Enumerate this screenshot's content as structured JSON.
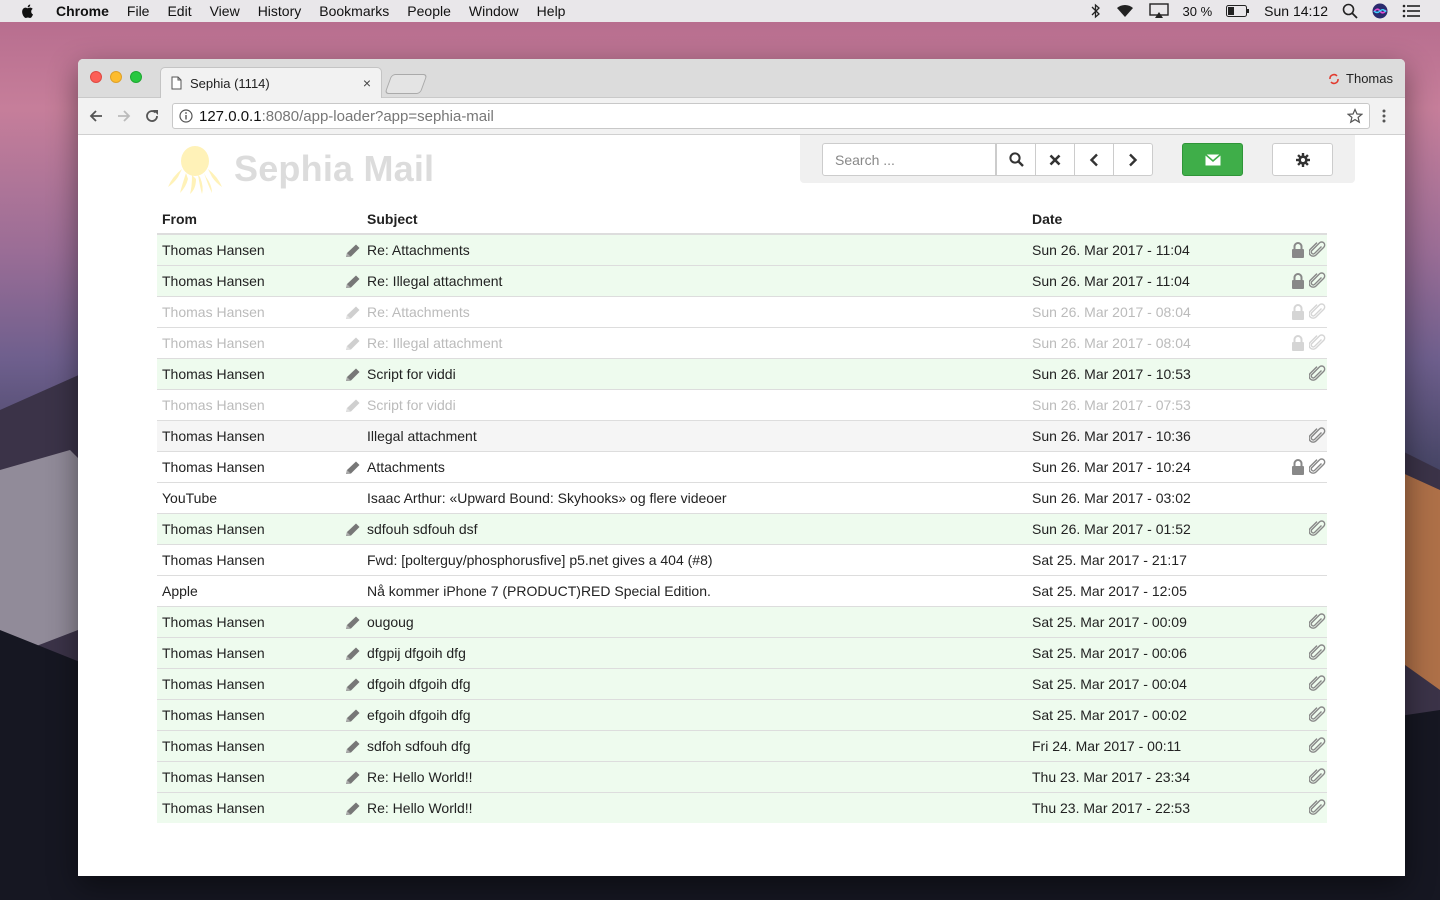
{
  "menubar": {
    "app": "Chrome",
    "items": [
      "File",
      "Edit",
      "View",
      "History",
      "Bookmarks",
      "People",
      "Window",
      "Help"
    ],
    "battery": "30 %",
    "clock": "Sun 14:12"
  },
  "browser": {
    "tab_title": "Sephia (1114)",
    "tab_close": "×",
    "profile": "Thomas",
    "url_host": "127.0.0.1",
    "url_path": ":8080/app-loader?app=sephia-mail"
  },
  "app": {
    "title": "Sephia Mail",
    "search_placeholder": "Search ...",
    "colors": {
      "compose": "#3fae49",
      "read_row": "#eefbee"
    }
  },
  "columns": {
    "from": "From",
    "subject": "Subject",
    "date": "Date"
  },
  "emails": [
    {
      "from": "Thomas Hansen",
      "subject": "Re: Attachments",
      "date": "Sun 26. Mar 2017 - 11:04",
      "edit": true,
      "lock": true,
      "attach": true,
      "style": "green"
    },
    {
      "from": "Thomas Hansen",
      "subject": "Re: Illegal attachment",
      "date": "Sun 26. Mar 2017 - 11:04",
      "edit": true,
      "lock": true,
      "attach": true,
      "style": "green"
    },
    {
      "from": "Thomas Hansen",
      "subject": "Re: Attachments",
      "date": "Sun 26. Mar 2017 - 08:04",
      "edit": true,
      "lock": true,
      "attach": true,
      "style": "faded"
    },
    {
      "from": "Thomas Hansen",
      "subject": "Re: Illegal attachment",
      "date": "Sun 26. Mar 2017 - 08:04",
      "edit": true,
      "lock": true,
      "attach": true,
      "style": "faded"
    },
    {
      "from": "Thomas Hansen",
      "subject": "Script for viddi",
      "date": "Sun 26. Mar 2017 - 10:53",
      "edit": true,
      "lock": false,
      "attach": true,
      "style": "green"
    },
    {
      "from": "Thomas Hansen",
      "subject": "Script for viddi",
      "date": "Sun 26. Mar 2017 - 07:53",
      "edit": true,
      "lock": false,
      "attach": false,
      "style": "faded"
    },
    {
      "from": "Thomas Hansen",
      "subject": "Illegal attachment",
      "date": "Sun 26. Mar 2017 - 10:36",
      "edit": false,
      "lock": false,
      "attach": true,
      "style": "gray"
    },
    {
      "from": "Thomas Hansen",
      "subject": "Attachments",
      "date": "Sun 26. Mar 2017 - 10:24",
      "edit": true,
      "lock": true,
      "attach": true,
      "style": "white"
    },
    {
      "from": "YouTube",
      "subject": "Isaac Arthur: «Upward Bound: Skyhooks» og flere videoer",
      "date": "Sun 26. Mar 2017 - 03:02",
      "edit": false,
      "lock": false,
      "attach": false,
      "style": "white"
    },
    {
      "from": "Thomas Hansen",
      "subject": "sdfouh sdfouh dsf",
      "date": "Sun 26. Mar 2017 - 01:52",
      "edit": true,
      "lock": false,
      "attach": true,
      "style": "green"
    },
    {
      "from": "Thomas Hansen",
      "subject": "Fwd: [polterguy/phosphorusfive] p5.net gives a 404 (#8)",
      "date": "Sat 25. Mar 2017 - 21:17",
      "edit": false,
      "lock": false,
      "attach": false,
      "style": "white"
    },
    {
      "from": "Apple",
      "subject": "Nå kommer iPhone 7 (PRODUCT)RED Special Edition.",
      "date": "Sat 25. Mar 2017 - 12:05",
      "edit": false,
      "lock": false,
      "attach": false,
      "style": "white"
    },
    {
      "from": "Thomas Hansen",
      "subject": "ougoug",
      "date": "Sat 25. Mar 2017 - 00:09",
      "edit": true,
      "lock": false,
      "attach": true,
      "style": "green"
    },
    {
      "from": "Thomas Hansen",
      "subject": "dfgpij dfgoih dfg",
      "date": "Sat 25. Mar 2017 - 00:06",
      "edit": true,
      "lock": false,
      "attach": true,
      "style": "green"
    },
    {
      "from": "Thomas Hansen",
      "subject": "dfgoih dfgoih dfg",
      "date": "Sat 25. Mar 2017 - 00:04",
      "edit": true,
      "lock": false,
      "attach": true,
      "style": "green"
    },
    {
      "from": "Thomas Hansen",
      "subject": "efgoih dfgoih dfg",
      "date": "Sat 25. Mar 2017 - 00:02",
      "edit": true,
      "lock": false,
      "attach": true,
      "style": "green"
    },
    {
      "from": "Thomas Hansen",
      "subject": "sdfoh sdfouh dfg",
      "date": "Fri 24. Mar 2017 - 00:11",
      "edit": true,
      "lock": false,
      "attach": true,
      "style": "green"
    },
    {
      "from": "Thomas Hansen",
      "subject": "Re: Hello World!!",
      "date": "Thu 23. Mar 2017 - 23:34",
      "edit": true,
      "lock": false,
      "attach": true,
      "style": "green"
    },
    {
      "from": "Thomas Hansen",
      "subject": "Re: Hello World!!",
      "date": "Thu 23. Mar 2017 - 22:53",
      "edit": true,
      "lock": false,
      "attach": true,
      "style": "green"
    }
  ]
}
